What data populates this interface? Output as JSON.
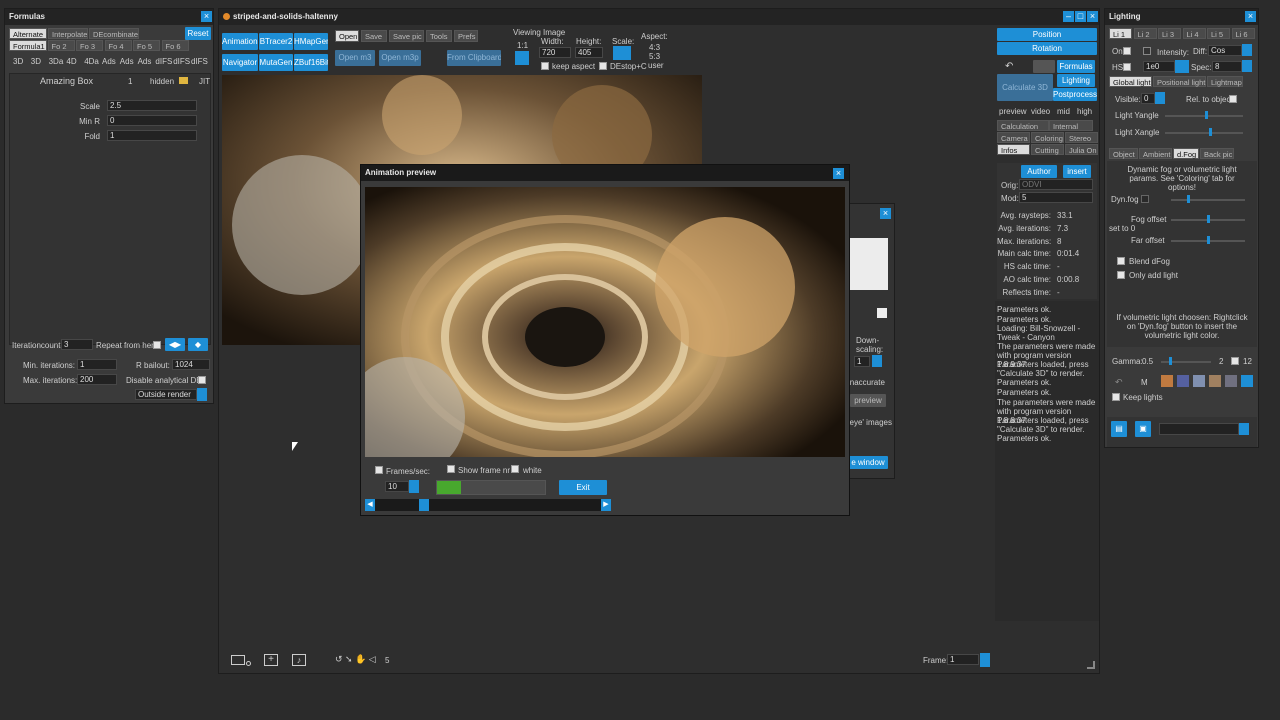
{
  "formulas": {
    "title": "Formulas",
    "tabs_top": [
      "Alternate",
      "Interpolate",
      "DEcombinate"
    ],
    "reset": "Reset",
    "tabs_formula": [
      "Formula1",
      "Fo 2",
      "Fo 3",
      "Fo 4",
      "Fo 5",
      "Fo 6"
    ],
    "dims": [
      "3D",
      "3D",
      "3Da",
      "4D",
      "4Da",
      "Ads",
      "Ads",
      "Ads",
      "dIFS",
      "dIFS",
      "dIFS"
    ],
    "formula_name": "Amazing Box",
    "formula_num": "1",
    "hidden": "hidden",
    "jit": "JIT",
    "params": [
      {
        "name": "Scale",
        "value": "2.5"
      },
      {
        "name": "Min R",
        "value": "0"
      },
      {
        "name": "Fold",
        "value": "1"
      }
    ],
    "iterationcount_label": "Iterationcount",
    "iterationcount_value": "3",
    "repeat_label": "Repeat from here",
    "min_iter_label": "Min. iterations:",
    "min_iter_value": "1",
    "max_iter_label": "Max. iterations:",
    "max_iter_value": "200",
    "rbailout_label": "R bailout:",
    "rbailout_value": "1024",
    "disable_de_label": "Disable analytical DE",
    "outside_render": "Outside render"
  },
  "main": {
    "title": "striped-and-solids-haltenny",
    "left_buttons": [
      "Animations",
      "BTracer2",
      "HMapGen",
      "Navigator",
      "MutaGen",
      "ZBuf16Bit"
    ],
    "tabs": [
      "Open",
      "Save",
      "Save pic",
      "Tools",
      "Prefs"
    ],
    "open_m3": "Open m3",
    "open_m3p": "Open m3p",
    "from_clipboard": "From Clipboard",
    "viewing_label": "Viewing",
    "viewing_value": "1:1",
    "image_label": "Image",
    "width_label": "Width:",
    "width_value": "720",
    "height_label": "Height:",
    "height_value": "405",
    "scale_label": "Scale:",
    "aspect_label": "Aspect:",
    "aspect_values": [
      "4:3",
      "5:3",
      "user"
    ],
    "keep_aspect": "keep aspect",
    "destop": "DEstop+C",
    "frame_label": "Frame:",
    "frame_value": "1",
    "bottom_count": "5"
  },
  "side": {
    "position": "Position",
    "rotation": "Rotation",
    "formulas": "Formulas",
    "lighting": "Lighting",
    "postprocess": "Postprocess",
    "calculate": "Calculate 3D",
    "quality": [
      "preview",
      "video",
      "mid",
      "high"
    ],
    "tabs1": [
      "Calculation",
      "Internal"
    ],
    "tabs2": [
      "Camera",
      "Coloring",
      "Stereo"
    ],
    "tabs3": [
      "Infos",
      "Cutting",
      "Julia On"
    ],
    "author": "Author",
    "insert": "insert",
    "orig_label": "Orig:",
    "orig_value": "ODVI",
    "mod_label": "Mod:",
    "mod_value": "5",
    "stats": [
      {
        "label": "Avg. raysteps:",
        "value": "33.1"
      },
      {
        "label": "Avg. iterations:",
        "value": "7.3"
      },
      {
        "label": "Max. iterations:",
        "value": "8"
      },
      {
        "label": "Main calc time:",
        "value": "0:01.4"
      },
      {
        "label": "HS calc time:",
        "value": "-"
      },
      {
        "label": "AO calc time:",
        "value": "0:00.8"
      },
      {
        "label": "Reflects time:",
        "value": "-"
      }
    ],
    "log": [
      "Parameters ok.",
      "Parameters ok.",
      "Loading: Bill-Snowzell - Tweak - Canyon",
      "The parameters were made with program version 1.8.9.37",
      "Parameters loaded, press \"Calculate 3D\" to render.",
      "Parameters ok.",
      "Parameters ok.",
      "The parameters were made with program version 1.8.8.37",
      "Parameters loaded, press \"Calculate 3D\" to render.",
      "Parameters ok."
    ]
  },
  "lighting": {
    "title": "Lighting",
    "light_tabs": [
      "Li 1",
      "Li 2",
      "Li 3",
      "Li 4",
      "Li 5",
      "Li 6"
    ],
    "on_label": "On",
    "intensity_label": "Intensity:",
    "diff_label": "Diff:",
    "diff_value": "Cos",
    "hs_label": "HS",
    "hs_value": "1e0",
    "spec_label": "Spec:",
    "spec_value": "8",
    "tabs_a": [
      "Global light",
      "Positional light",
      "Lightmap"
    ],
    "visible_label": "Visible:",
    "visible_value": "0",
    "rel_obj": "Rel. to object",
    "yangle": "Light Yangle",
    "xangle": "Light Xangle",
    "tabs_b": [
      "Object",
      "Ambient",
      "d.Fog",
      "Back pic"
    ],
    "dfog_text": "Dynamic fog or volumetric light params. See 'Coloring' tab for options!",
    "dynfog": "Dyn.fog",
    "fog_offset": "Fog offset",
    "set_to_0": "set to 0",
    "far_offset": "Far offset",
    "blend_dfog": "Blend dFog",
    "only_add": "Only add light",
    "volumetric_text": "If volumetric light choosen: Rightclick on 'Dyn.fog' button to insert the volumetric light color.",
    "gamma_label": "Gamma:",
    "gamma_value": "0.5",
    "gamma_max": "2",
    "gamma_box": "12",
    "m_label": "M",
    "keep_lights": "Keep lights"
  },
  "anim": {
    "title": "Animation preview",
    "frames_label": "Frames/sec:",
    "frames_value": "10",
    "show_frame": "Show frame nr",
    "white": "white",
    "exit": "Exit",
    "progress": 0.22
  },
  "behind": {
    "downscaling": "Down-\nscaling:",
    "ds_value": "1",
    "inaccurate": "inaccurate",
    "preview": "preview",
    "eye": "'eye' images",
    "window_btn": "e window"
  }
}
